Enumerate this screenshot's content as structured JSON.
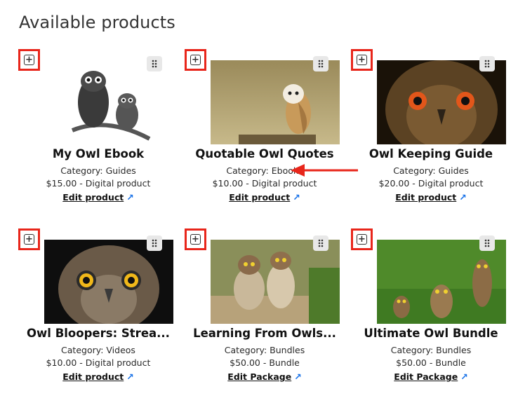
{
  "page": {
    "title": "Available products"
  },
  "products": [
    {
      "title": "My Owl Ebook",
      "category": "Category: Guides",
      "price": "$15.00 - Digital product",
      "edit": "Edit product",
      "image": "sketch-owls"
    },
    {
      "title": "Quotable Owl Quotes",
      "category": "Category: Ebooks",
      "price": "$10.00 - Digital product",
      "edit": "Edit product",
      "image": "barn-owl"
    },
    {
      "title": "Owl Keeping Guide",
      "category": "Category: Guides",
      "price": "$20.00 - Digital product",
      "edit": "Edit product",
      "image": "eagle-owl-closeup"
    },
    {
      "title": "Owl Bloopers: Strea...",
      "category": "Category: Videos",
      "price": "$10.00 - Digital product",
      "edit": "Edit product",
      "image": "owl-yellow-eyes"
    },
    {
      "title": "Learning From Owls...",
      "category": "Category: Bundles",
      "price": "$50.00 - Bundle",
      "edit": "Edit Package",
      "image": "burrowing-owls-pair"
    },
    {
      "title": "Ultimate Owl Bundle",
      "category": "Category: Bundles",
      "price": "$50.00 - Bundle",
      "edit": "Edit Package",
      "image": "burrowing-owls-grass"
    }
  ],
  "icons": {
    "add": "plus-square-icon",
    "drag": "drag-handle-icon",
    "external": "external-arrow-icon"
  },
  "colors": {
    "highlight": "#e8261b",
    "link_arrow": "#1a73e8"
  }
}
